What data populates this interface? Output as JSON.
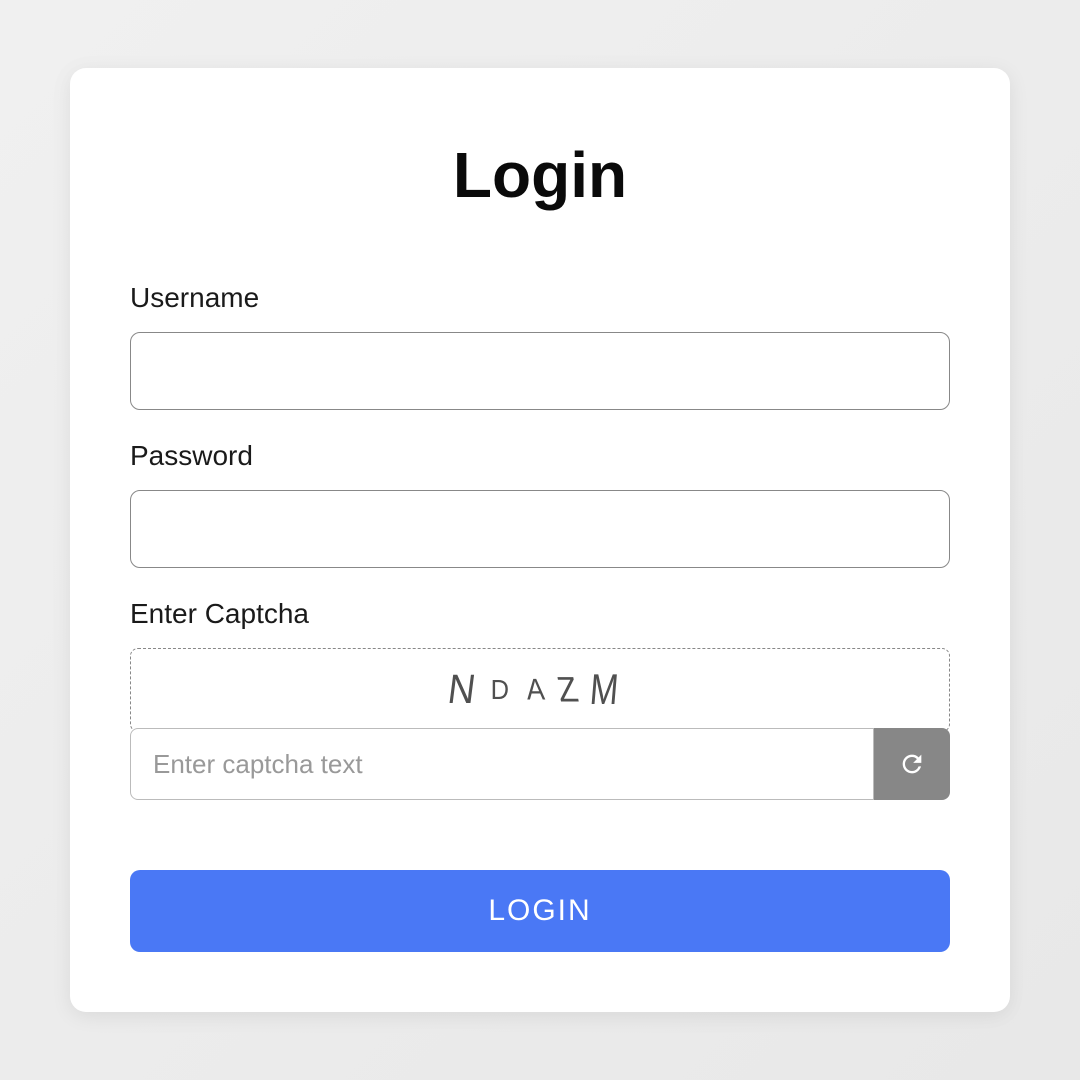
{
  "form": {
    "title": "Login",
    "username": {
      "label": "Username",
      "value": ""
    },
    "password": {
      "label": "Password",
      "value": ""
    },
    "captcha": {
      "label": "Enter Captcha",
      "display_text": "NDAZM",
      "input_placeholder": "Enter captcha text",
      "input_value": ""
    },
    "submit_label": "LOGIN"
  },
  "icons": {
    "refresh": "refresh-icon"
  },
  "colors": {
    "primary": "#4a78f5",
    "card_bg": "#ffffff",
    "page_bg": "#f0f0f0",
    "border": "#888888",
    "refresh_bg": "#878787"
  }
}
